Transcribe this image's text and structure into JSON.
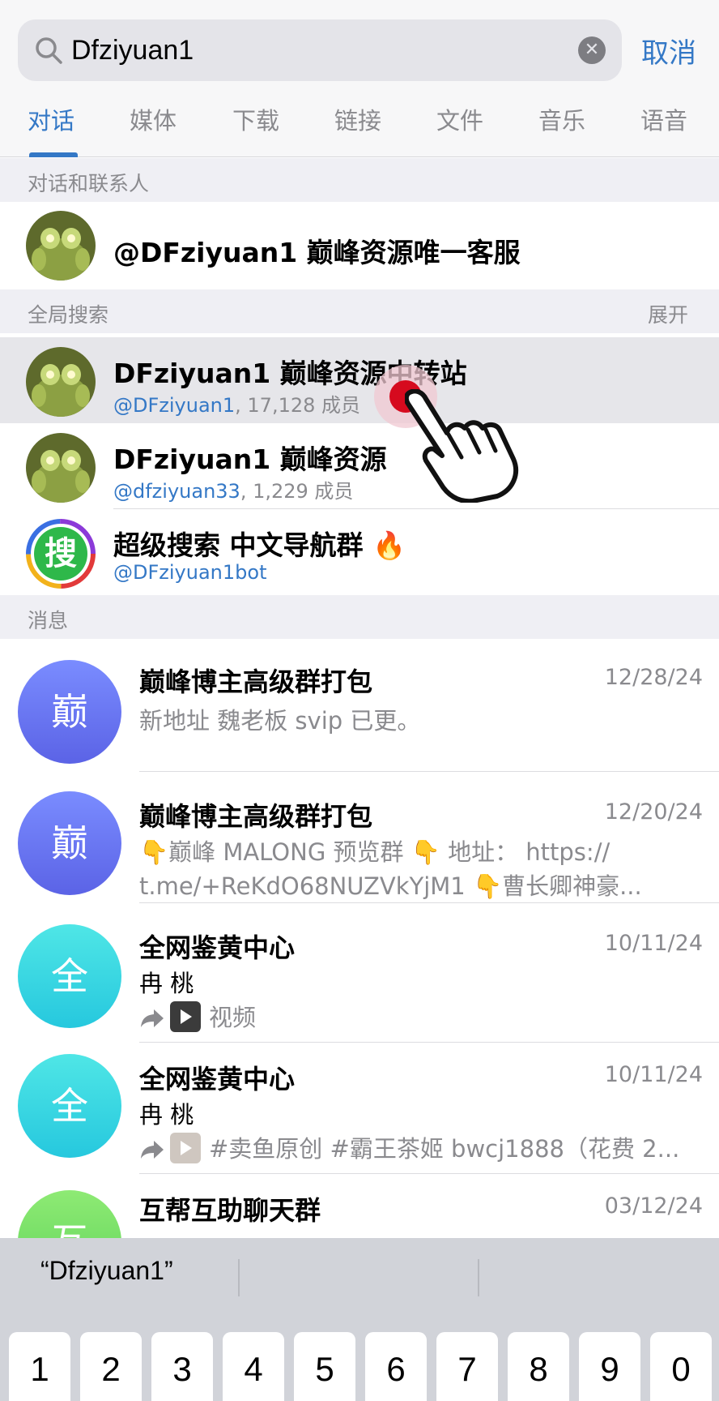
{
  "search": {
    "query": "Dfziyuan1",
    "cancel_label": "取消"
  },
  "tabs": [
    {
      "label": "对话",
      "active": true
    },
    {
      "label": "媒体"
    },
    {
      "label": "下载"
    },
    {
      "label": "链接"
    },
    {
      "label": "文件"
    },
    {
      "label": "音乐"
    },
    {
      "label": "语音"
    }
  ],
  "contacts_section": {
    "title": "对话和联系人",
    "items": [
      {
        "title": "@DFziyuan1 巅峰资源唯一客服"
      }
    ]
  },
  "global_section": {
    "title": "全局搜索",
    "action": "展开",
    "items": [
      {
        "title": "DFziyuan1 巅峰资源中转站",
        "handle": "@DFziyuan1",
        "members": ", 17,128 成员"
      },
      {
        "title": "DFziyuan1 巅峰资源",
        "handle": "@dfziyuan33",
        "members": ", 1,229 成员"
      },
      {
        "title": "超级搜索 中文导航群 🔥",
        "handle": "@DFziyuan1bot",
        "members": ""
      }
    ],
    "search_logo_char": "搜"
  },
  "messages_section": {
    "title": "消息",
    "items": [
      {
        "avatar": "巅",
        "avatar_color": "#6a74f0",
        "title": "巅峰博主高级群打包",
        "date": "12/28/24",
        "line1": "新地址 魏老板 svip 已更。"
      },
      {
        "avatar": "巅",
        "avatar_color": "#6a74f0",
        "title": "巅峰博主高级群打包",
        "date": "12/20/24",
        "line1": "👇巅峰 MALONG   预览群 👇 地址： https://",
        "line2": "t.me/+ReKdO68NUZVkYjM1 👇曹长卿神豪..."
      },
      {
        "avatar": "全",
        "avatar_color": "#35d4e2",
        "title": "全网鉴黄中心",
        "date": "10/11/24",
        "line1": "冉 桃",
        "line2": "视频"
      },
      {
        "avatar": "全",
        "avatar_color": "#35d4e2",
        "title": "全网鉴黄中心",
        "date": "10/11/24",
        "line1": "冉 桃",
        "line2": "#卖鱼原创 #霸王茶姬 bwcj1888（花费 2..."
      },
      {
        "avatar": "互",
        "avatar_color": "#72dc63",
        "title": "互帮互助聊天群",
        "date": "03/12/24"
      }
    ]
  },
  "keyboard": {
    "suggestion": "“Dfziyuan1”",
    "keys": [
      "1",
      "2",
      "3",
      "4",
      "5",
      "6",
      "7",
      "8",
      "9",
      "0"
    ]
  }
}
